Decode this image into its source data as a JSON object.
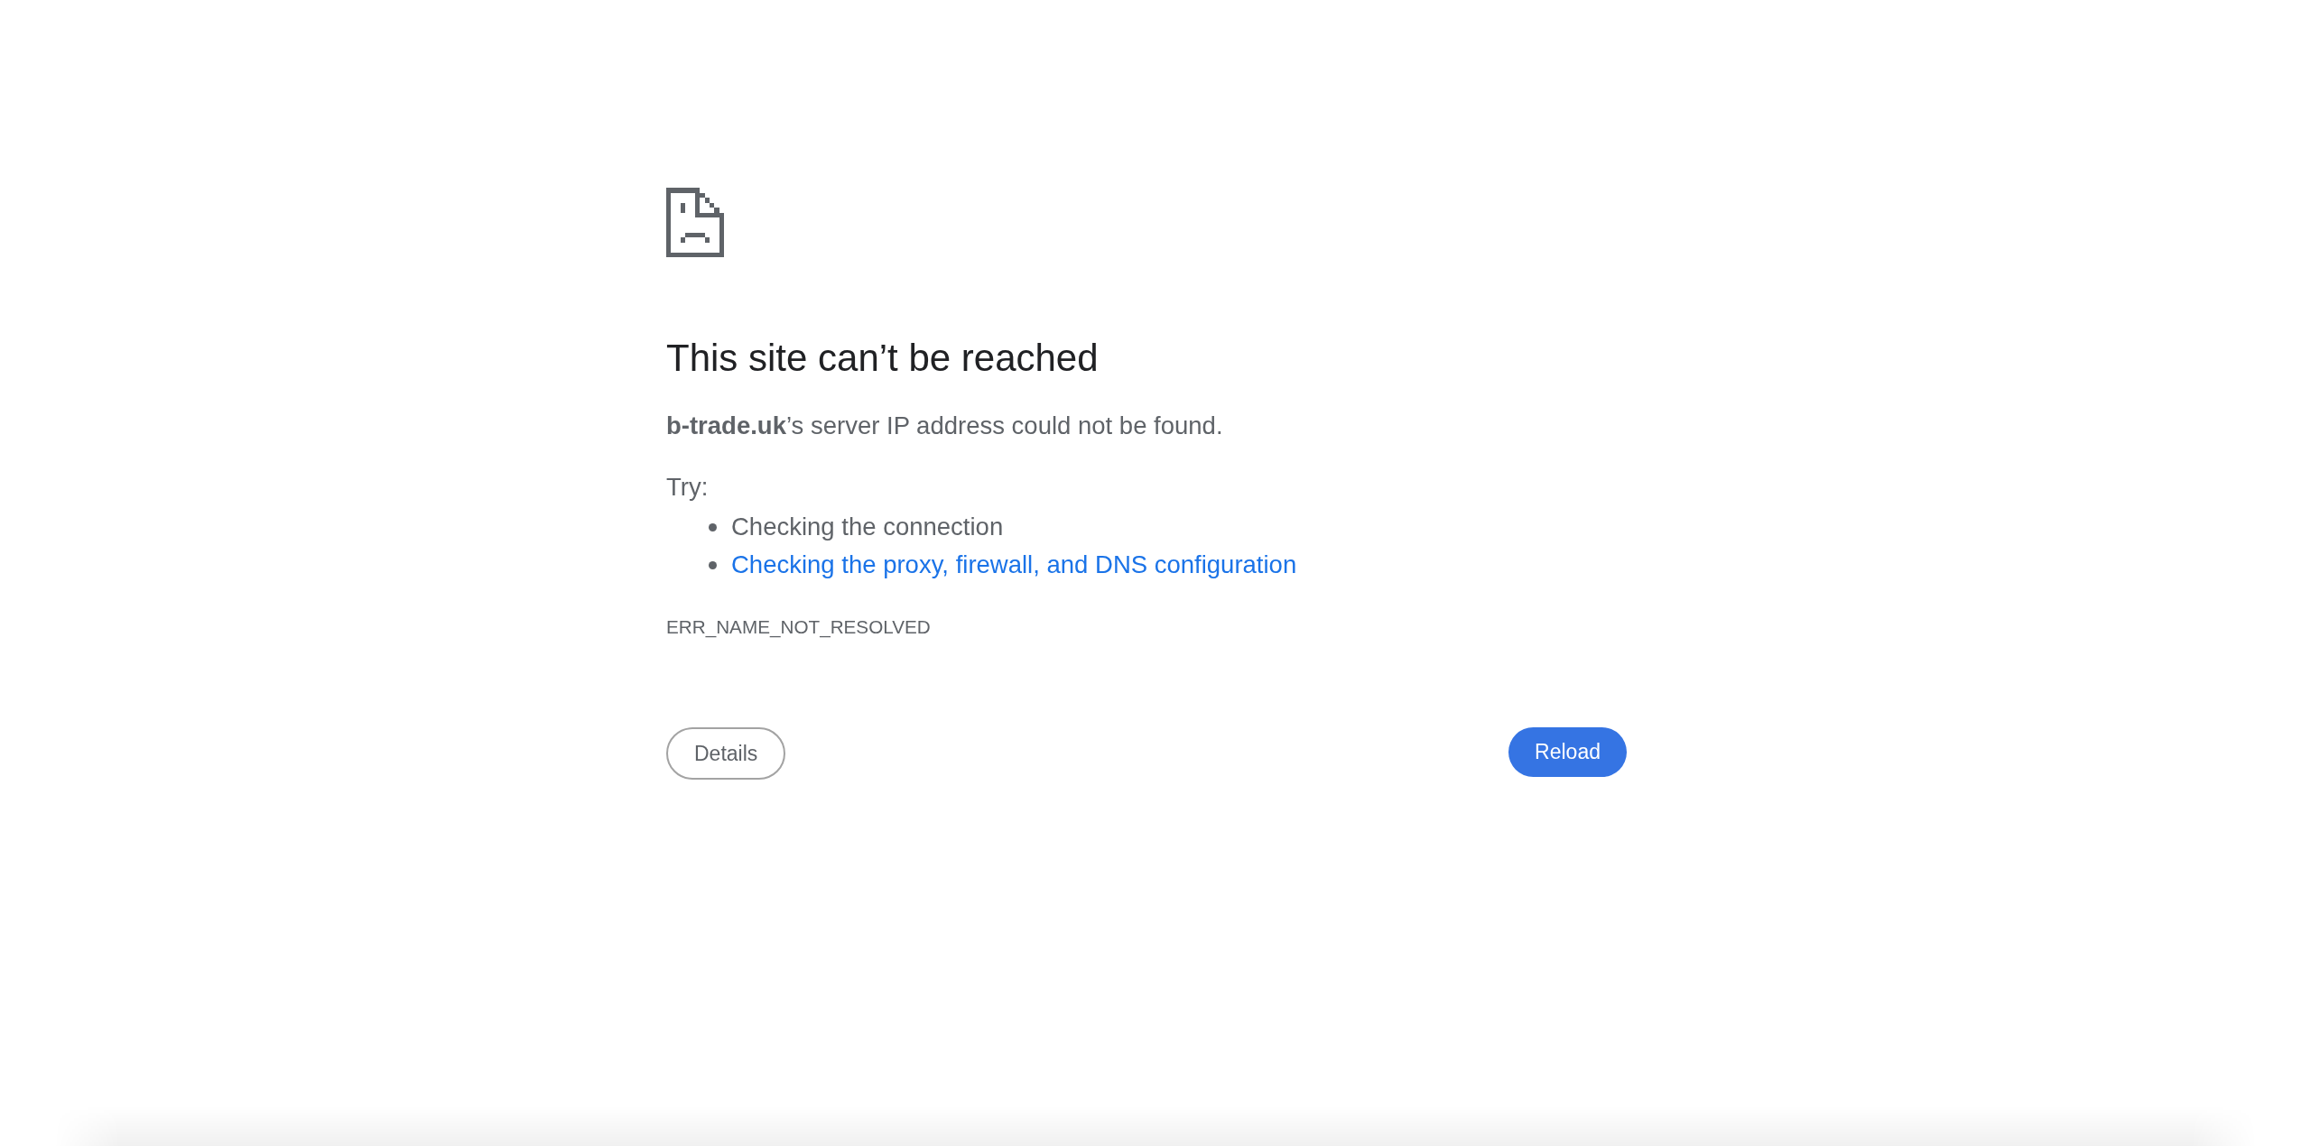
{
  "page": {
    "heading": "This site can’t be reached",
    "message": "**b-trade.uk**’s server IP address could not be found.",
    "try_label": "Try:",
    "suggestions": [
      {
        "kind": "text",
        "text": "Checking the connection"
      },
      {
        "kind": "link",
        "text": "Checking the proxy, firewall, and DNS configuration"
      }
    ],
    "error_code": "ERR_NAME_NOT_RESOLVED"
  },
  "buttons": [
    {
      "kind": "secondary",
      "label": "Details"
    },
    {
      "kind": "primary",
      "label": "Reload"
    }
  ]
}
